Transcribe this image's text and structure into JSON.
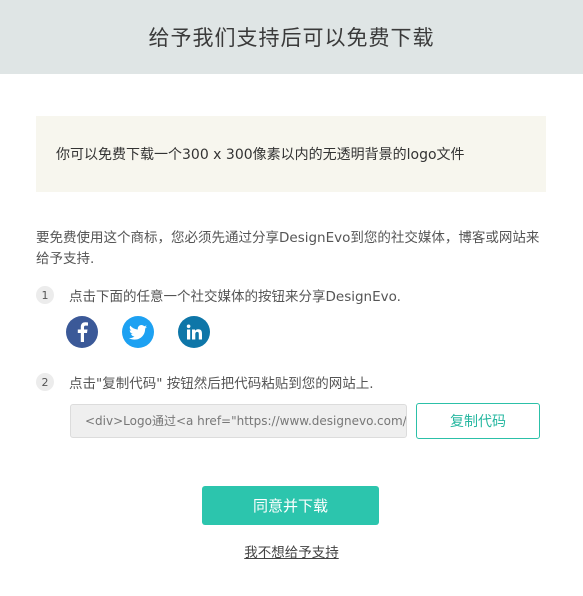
{
  "header": {
    "title": "给予我们支持后可以免费下载"
  },
  "notice": {
    "text": "你可以免费下载一个300 x 300像素以内的无透明背景的logo文件"
  },
  "intro": {
    "text": "要免费使用这个商标，您必须先通过分享DesignEvo到您的社交媒体，博客或网站来给予支持."
  },
  "steps": [
    {
      "number": "1",
      "text": "点击下面的任意一个社交媒体的按钮来分享DesignEvo."
    },
    {
      "number": "2",
      "text": "点击\"复制代码\" 按钮然后把代码粘贴到您的网站上."
    }
  ],
  "social": {
    "icons": [
      "facebook-icon",
      "twitter-icon",
      "linkedin-icon"
    ],
    "colors": {
      "facebook": "#3b5998",
      "twitter": "#1da1f2",
      "linkedin": "#0e76a8"
    }
  },
  "code": {
    "value": "<div>Logo通过<a href=\"https://www.designevo.com/",
    "copy_label": "复制代码"
  },
  "actions": {
    "agree_label": "同意并下载",
    "decline_label": "我不想给予支持"
  },
  "colors": {
    "accent": "#2cc5ad",
    "header_bg": "#dfe5e5",
    "notice_bg": "#f7f6ee"
  }
}
